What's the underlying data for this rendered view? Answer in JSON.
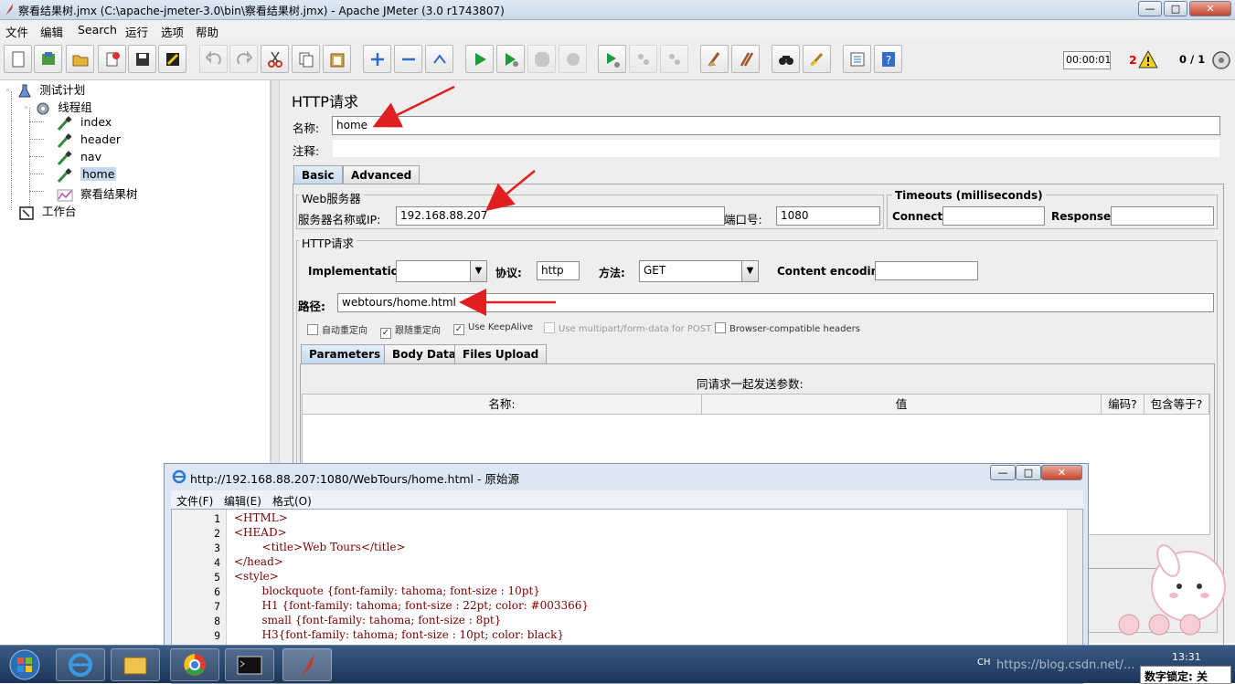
{
  "window": {
    "title": "察看结果树.jmx (C:\\apache-jmeter-3.0\\bin\\察看结果树.jmx) - Apache JMeter (3.0 r1743807)",
    "minimize": "—",
    "maximize": "□",
    "close": "✕"
  },
  "menu": [
    "文件",
    "编辑",
    "Search",
    "运行",
    "选项",
    "帮助"
  ],
  "toolbar": {
    "elapsed": "00:00:01",
    "warnings": "2",
    "threads": "0 / 1"
  },
  "tree": {
    "root": "测试计划",
    "thread_group": "线程组",
    "samplers": [
      "index",
      "header",
      "nav",
      "home"
    ],
    "selected": "home",
    "listener": "察看结果树",
    "workbench": "工作台"
  },
  "panel": {
    "title": "HTTP请求",
    "name_label": "名称:",
    "name_value": "home",
    "comment_label": "注释:",
    "comment_value": "",
    "tabs": [
      "Basic",
      "Advanced"
    ],
    "web_server": {
      "title": "Web服务器",
      "server_label": "服务器名称或IP:",
      "server_value": "192.168.88.207",
      "port_label": "端口号:",
      "port_value": "1080"
    },
    "timeouts": {
      "title": "Timeouts (milliseconds)",
      "connect_label": "Connect:",
      "connect_value": "",
      "response_label": "Response:",
      "response_value": ""
    },
    "http_request": {
      "title": "HTTP请求",
      "impl_label": "Implementation:",
      "impl_value": "",
      "protocol_label": "协议:",
      "protocol_value": "http",
      "method_label": "方法:",
      "method_value": "GET",
      "encoding_label": "Content encoding:",
      "encoding_value": "",
      "path_label": "路径:",
      "path_value": "webtours/home.html"
    },
    "checkboxes": [
      {
        "label": "自动重定向",
        "checked": false,
        "enabled": true
      },
      {
        "label": "跟随重定向",
        "checked": true,
        "enabled": true
      },
      {
        "label": "Use KeepAlive",
        "checked": true,
        "enabled": true
      },
      {
        "label": "Use multipart/form-data for POST",
        "checked": false,
        "enabled": false
      },
      {
        "label": "Browser-compatible headers",
        "checked": false,
        "enabled": true
      }
    ],
    "param_tabs": [
      "Parameters",
      "Body Data",
      "Files Upload"
    ],
    "params_caption": "同请求一起发送参数:",
    "params_columns": [
      "名称:",
      "值",
      "编码?",
      "包含等于?"
    ]
  },
  "source_window": {
    "title": "http://192.168.88.207:1080/WebTours/home.html - 原始源",
    "menu": [
      "文件(F)",
      "编辑(E)",
      "格式(O)"
    ],
    "lines": [
      {
        "n": "1",
        "text": "<HTML>"
      },
      {
        "n": "2",
        "text": "<HEAD>"
      },
      {
        "n": "3",
        "text": "        <title>Web Tours</title>"
      },
      {
        "n": "4",
        "text": "</head>"
      },
      {
        "n": "5",
        "text": "<style>"
      },
      {
        "n": "6",
        "text": "        blockquote {font-family: tahoma; font-size : 10pt}"
      },
      {
        "n": "7",
        "text": "        H1 {font-family: tahoma; font-size : 22pt; color: #003366}"
      },
      {
        "n": "8",
        "text": "        small {font-family: tahoma; font-size : 8pt}"
      },
      {
        "n": "9",
        "text": "        H3{font-family: tahoma; font-size : 10pt; color: black}"
      }
    ]
  },
  "taskbar": {
    "lang": "CH",
    "clock": "13:31",
    "watermark": "https://blog.csdn.net/...",
    "numlock": "数字锁定: 关"
  },
  "colors": {
    "accent_arrow": "#e02020",
    "selection": "#c5d7ee",
    "panel_bg": "#eeeeee"
  }
}
